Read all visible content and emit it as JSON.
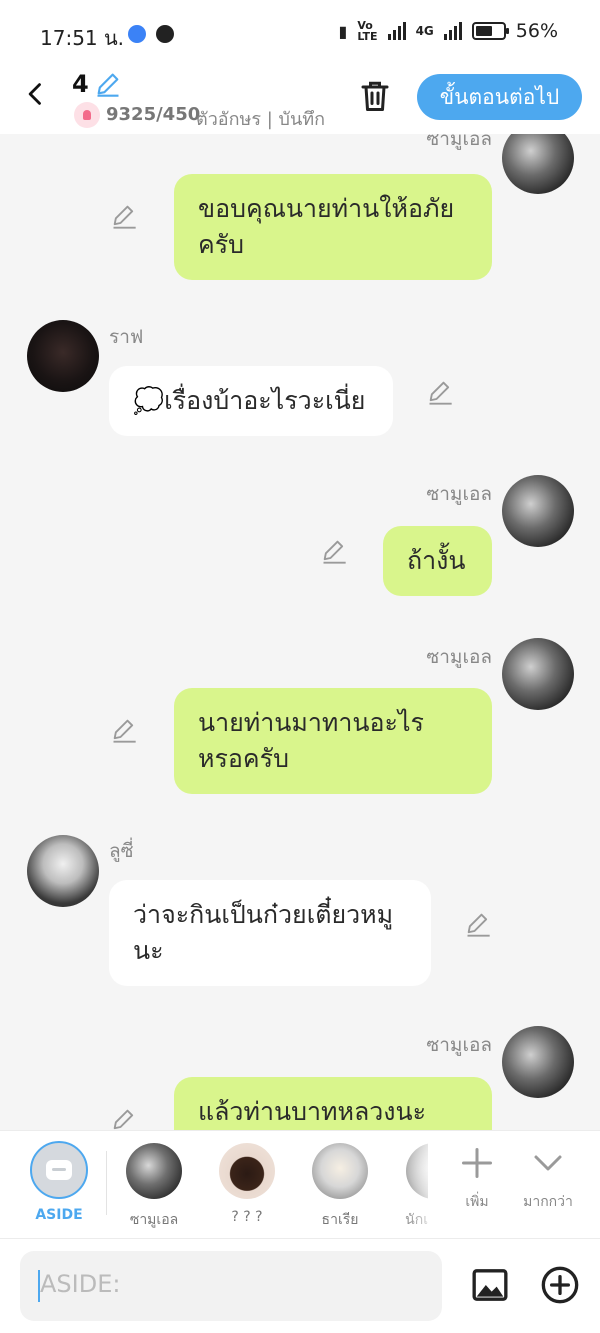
{
  "status_bar": {
    "time": "17:51 น.",
    "network": "4G",
    "battery": "56%"
  },
  "header": {
    "episode": "4",
    "char_count": "9325/450",
    "status_text": "ตัวอักษร | บันทึก",
    "next_label": "ขั้นตอนต่อไป"
  },
  "messages": [
    {
      "name": "ซามูเอล",
      "side": "right",
      "text": "ขอบคุณนายท่านให้อภัยครับ"
    },
    {
      "name": "ราฟ",
      "side": "left",
      "text": "💭เรื่องบ้าอะไรวะเนี่ย"
    },
    {
      "name": "ซามูเอล",
      "side": "right",
      "text": "ถ้างั้น"
    },
    {
      "name": "ซามูเอล",
      "side": "right",
      "text": "นายท่านมาทานอะไรหรอครับ"
    },
    {
      "name": "ลูซี่",
      "side": "left",
      "text": "ว่าจะกินเป็นก๋วยเตี๋ยวหมูนะ"
    },
    {
      "name": "ซามูเอล",
      "side": "right",
      "text": "แล้วท่านบาทหลวงนะ"
    }
  ],
  "character_bar": {
    "aside_label": "ASIDE",
    "characters": [
      "ซามูเอล",
      "? ? ?",
      "ธาเรีย",
      "นักเ"
    ],
    "add_label": "เพิ่ม",
    "more_label": "มากกว่า"
  },
  "input": {
    "placeholder": "ASIDE:"
  }
}
